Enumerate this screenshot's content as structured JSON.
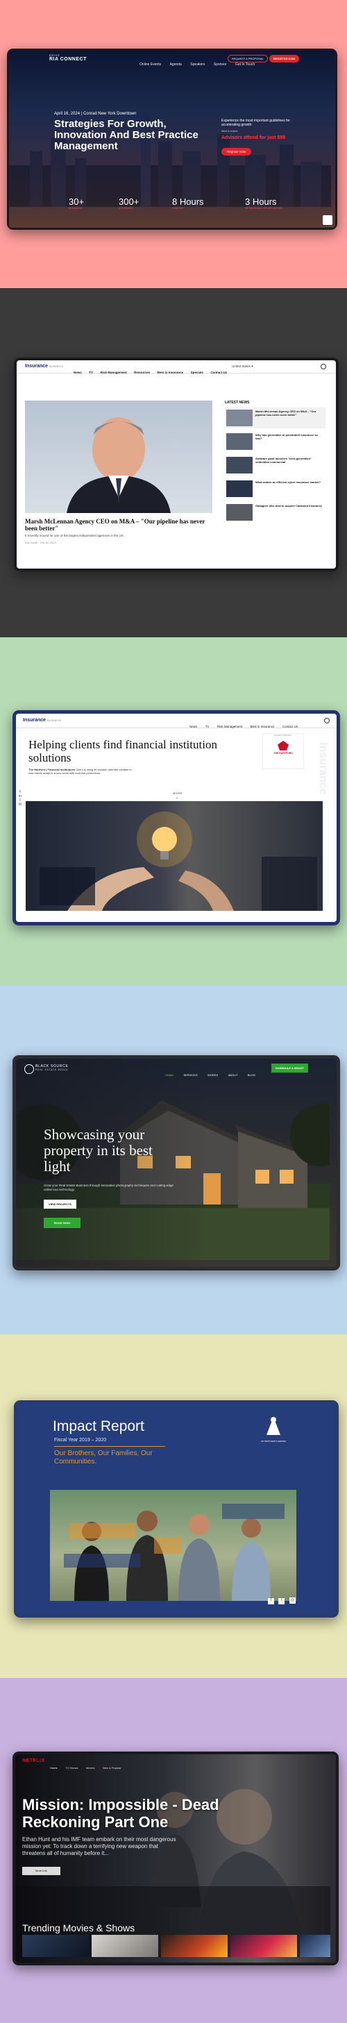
{
  "p1": {
    "bg": "#ff9d9b",
    "logo_top": "DRIVE",
    "logo": "RIA CONNECT",
    "nav": [
      "Online Events",
      "Agenda",
      "Speakers",
      "Sponsor",
      "Get In Touch"
    ],
    "nav_btn1": "REQUEST A PROPOSAL",
    "nav_btn2": "REGISTER NOW",
    "date": "April 16, 2024 | Conrad New York Downtown",
    "headline": "Strategies For Growth, Innovation And Best Practice Management",
    "side_text": "Experience the most important guidelines for accelerating growth",
    "side_small": "What to expect",
    "side_early": "Advisors attend for just $99",
    "side_btn": "Register Now",
    "stats": [
      {
        "value": "30+",
        "label": "SPEAKERS"
      },
      {
        "value": "300+",
        "label": "ATTENDEES"
      },
      {
        "value": "8 Hours",
        "label": "CONTENT"
      },
      {
        "value": "3 Hours",
        "label": "NETWORKING OPPORTUNITIES"
      }
    ]
  },
  "p2": {
    "bg": "#3a3a3a",
    "logo": "Insurance",
    "logo_suffix": "BUSINESS",
    "nav": [
      "News",
      "TV",
      "Risk Management",
      "Resources",
      "Best in Insurance",
      "Specials",
      "Contact Us"
    ],
    "region": "United States",
    "article_title": "Marsh McLennan Agency CEO on M&A – \"Our pipeline has never been better\"",
    "article_sub": "It recently moved for one of the largest independent agencies in the US",
    "article_meta": "Eric Smith  ·  Oct 16, 2023",
    "latest": "LATEST NEWS",
    "news": [
      "Marsh McLennan Agency CEO on M&A – \"Our pipeline has never been better\"",
      "Why has generative AI penetrated insurance so fast?",
      "Software giant launches \"next-generation\" embedded commercial",
      "What makes an efficient cyber insurance market?",
      "Gallagher inks deal to acquire Cadwood Insurance"
    ]
  },
  "p3": {
    "bg": "#b7dbb4",
    "logo": "Insurance",
    "logo_suffix": "BUSINESS",
    "nav": [
      "News",
      "TV",
      "Risk Management",
      "Best in Insurance",
      "Contact Us"
    ],
    "title": "Helping clients find financial institution solutions",
    "body_lead": "The Hartford | Financial Institutions",
    "body": "Client is using its solution-oriented mindset to help clients adapt to a new world with bold risk protections",
    "share": [
      "f",
      "in",
      "t",
      "✉"
    ],
    "more": "MORE",
    "ad_label": "ADVERTISEMENT",
    "ad_brand": "THE HARTFORD",
    "side_watermark": "Insurance"
  },
  "p4": {
    "bg": "#bcd6ee",
    "logo": "BLACK SOURCE",
    "logo_sub": "REAL ESTATE MEDIA",
    "nav": [
      "HOME",
      "SERVICES",
      "WORKS",
      "ABOUT",
      "BLOG"
    ],
    "nav_btn": "SCHEDULE A SHOOT",
    "headline": "Showcasing your property in its best light",
    "sub": "Grow your Real Estate Business through innovative photography techniques and cutting-edge online tour technology.",
    "btn1": "VIEW PROJECTS",
    "btn2": "BOOK NOW"
  },
  "p5": {
    "bg": "#e8e6b6",
    "title": "Impact Report",
    "year": "Fiscal Year 2019 – 2020",
    "tagline": "Our Brothers, Our Families, Our Communities.",
    "brand": "MY BROTHER'S KEEPER",
    "social": [
      "f",
      "t",
      "◎"
    ]
  },
  "p6": {
    "bg": "#c9b1df",
    "logo": "NETFLIX",
    "nav": [
      "Home",
      "TV Shows",
      "Movies",
      "New & Popular"
    ],
    "title": "Mission: Impossible - Dead Reckoning Part One",
    "desc": "Ethan Hunt and his IMF team embark on their most dangerous mission yet: To track down a terrifying new weapon that threatens all of humanity before it...",
    "btn": "More Info",
    "trending": "Trending Movies & Shows"
  }
}
